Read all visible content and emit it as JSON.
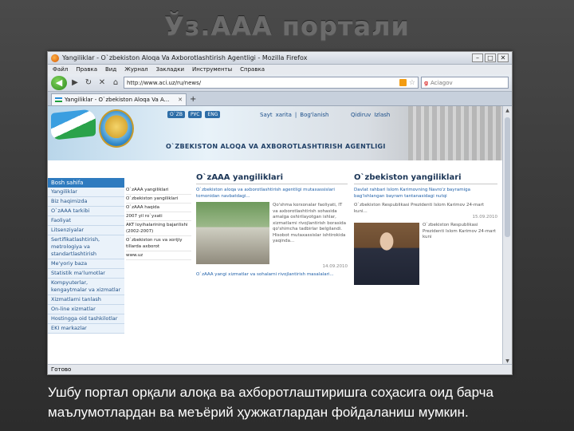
{
  "slide": {
    "title": "Ўз.ААА портали",
    "caption": "Ушбу портал орқали алоқа ва ахборотлаштиришга соҳасига оид барча маълумотлардан ва меъёрий ҳужжатлардан фойдаланиш мумкин."
  },
  "browser": {
    "window_title": "Yangiliklar - O`zbekiston Aloqa Va Axborotlashtirish Agentligi - Mozilla Firefox",
    "menu": [
      "Файл",
      "Правка",
      "Вид",
      "Журнал",
      "Закладки",
      "Инструменты",
      "Справка"
    ],
    "url": "http://www.aci.uz/ru/news/",
    "search_placeholder": "Aciagov",
    "search_engine_glyph": "g",
    "tab_label": "Yangiliklar - O`zbekiston Aloqa Va A...",
    "status": "Готово"
  },
  "site": {
    "lang_chips": [
      "O`ZB",
      "РУС",
      "ENG"
    ],
    "links_left": [
      "Sayt",
      "xarita",
      "|",
      "Bog'lanish"
    ],
    "links_right": [
      "Qidiruv",
      "Izlash"
    ],
    "agency_name": "O`ZBEKISTON ALOQA VA AXBOROTLASHTIRISH AGENTLIGI",
    "sidebar_heading": "Bosh sahifa",
    "sidebar_items": [
      "Yangiliklar",
      "Biz haqimizda",
      "O`zAAA tarkibi",
      "Faoliyat",
      "Litsenziyalar",
      "Sertifikatlashtirish, metrologiya va standartlashtirish",
      "Me'yoriy baza",
      "Statistik ma'lumotlar",
      "Kompyuterlar, kengaytmalar va xizmatlar",
      "Xizmatlarni tanlash",
      "On-line xizmatlar",
      "Hostingga oid tashkilotlar",
      "EKI markazlar"
    ],
    "side_links": [
      "O`zAAA yangiliklari",
      "O`zbekiston yangiliklari",
      "O`zAAA haqida",
      "2007 yil ro`yxati",
      "AKT loyihalarining bajarilishi (2002-2007)",
      "O`zbekiston rus va xorijiy tillarda axborot",
      "www.uz"
    ],
    "uzaaa_news": {
      "title": "O`zAAA yangiliklari",
      "lead": "O`zbekiston aloqa va axborotlashtirish agentligi mutaxassislari tomonidan navbatdagi...",
      "body": "Qo'shma korxonalar faoliyati, IT va axborotlashtirish sohasida amalga oshirilayotgan ishlar, xizmatlarni rivojlantirish borasida qo'shimcha tadbirlar belgilandi. Hisobot mutaxassislar ishtirokida yaqinda...",
      "date": "14.09.2010",
      "link": "O`zAAA yangi xizmatlar va sohalarni rivojlantirish masalalari..."
    },
    "uz_news": {
      "title": "O`zbekiston yangiliklari",
      "lead": "Davlat rahbari Islom Karimovning Navro'z bayramiga bag'ishlangan bayram tantanasidagi nutqi",
      "body": "O`zbekiston Respublikasi Prezidenti Islom Karimov 24-mart kuni...",
      "date": "15.09.2010",
      "caption": "O`zbekiston Respublikasi Prezidenti Islom Karimov 24-mart kuni"
    }
  }
}
